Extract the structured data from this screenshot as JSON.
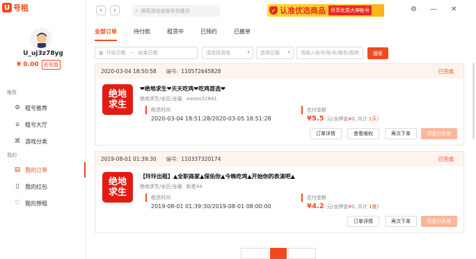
{
  "app": {
    "logo_mark": "U",
    "logo_text": "号租"
  },
  "user": {
    "name": "U_uj3z78yg",
    "balance": "¥ 0.00",
    "recharge_label": "去充值"
  },
  "sidebar": {
    "section_recommend": "推荐",
    "section_mine": "我的",
    "items": [
      {
        "label": "租号推荐",
        "icon": "gear-icon"
      },
      {
        "label": "租号大厅",
        "icon": "home-icon"
      },
      {
        "label": "游戏分类",
        "icon": "gamepad-icon"
      },
      {
        "label": "我的订单",
        "icon": "document-icon",
        "active": true
      },
      {
        "label": "我的红包",
        "icon": "gift-icon"
      },
      {
        "label": "我的想租",
        "icon": "heart-icon"
      }
    ]
  },
  "topbar": {
    "search_placeholder": "搜索游戏或账号关键词",
    "banner_title": "认准优选商品",
    "banner_tag": "尽享优质大神帐号"
  },
  "tabs": [
    "全部订单",
    "待付款",
    "租赁中",
    "已预约",
    "已撤单"
  ],
  "filters": {
    "start_date": "开始日期",
    "separator": "~",
    "end_date": "结束日期",
    "game": "请选择游戏",
    "server": "选择区服",
    "keyword": "请输入账号/账号/角色/昵称",
    "search_button": "搜索"
  },
  "orders": [
    {
      "date": "2020-03-04 18:50:58",
      "no_label": "编号:",
      "no": "110572645828",
      "status": "已完成",
      "thumb_line1": "绝地",
      "thumb_line2": "求生",
      "title": "❤绝地求生❤天天吃鸡❤吃鸡首选❤",
      "sub": "绝地求生/全区/全服",
      "account": "xwsex32841",
      "time_label": "租赁时间",
      "time": "2020-03-04 18:51:28/2020-03-05 18:51:28",
      "amount_label": "应付金额",
      "price": "¥5.5",
      "amount_detail_a": "元(含押金",
      "deposit": "¥0",
      "amount_detail_b": ", 共计",
      "duration": "1天",
      "amount_detail_c": ")",
      "buttons": [
        "订单详情",
        "查看维权",
        "再次下单",
        "切盘已失效"
      ]
    },
    {
      "date": "2019-08-01 01:39:30",
      "no_label": "编号:",
      "no": "110337320174",
      "status": "已完成",
      "thumb_line1": "绝地",
      "thumb_line2": "求生",
      "title": "【玲玲出租】▲全职商家▲保佑你▲今晚吃鸡▲开始你的表演吧▲",
      "sub": "绝地求生/全区/全服",
      "account": "新老44",
      "time_label": "租赁时间",
      "time": "2019-08-01 01:39:30/2019-08-01 08:00:00",
      "amount_label": "应付金额",
      "price": "¥4.2",
      "amount_detail_a": "元(含押金",
      "deposit": "¥0",
      "amount_detail_b": ", 共计",
      "duration": "1夜",
      "amount_detail_c": ")",
      "buttons": [
        "订单详情",
        "再次下单",
        "切盘已失效"
      ]
    }
  ],
  "colors": {
    "accent": "#f04a1f",
    "banner": "#ffc12a",
    "disabled_button": "#f8b69b"
  }
}
